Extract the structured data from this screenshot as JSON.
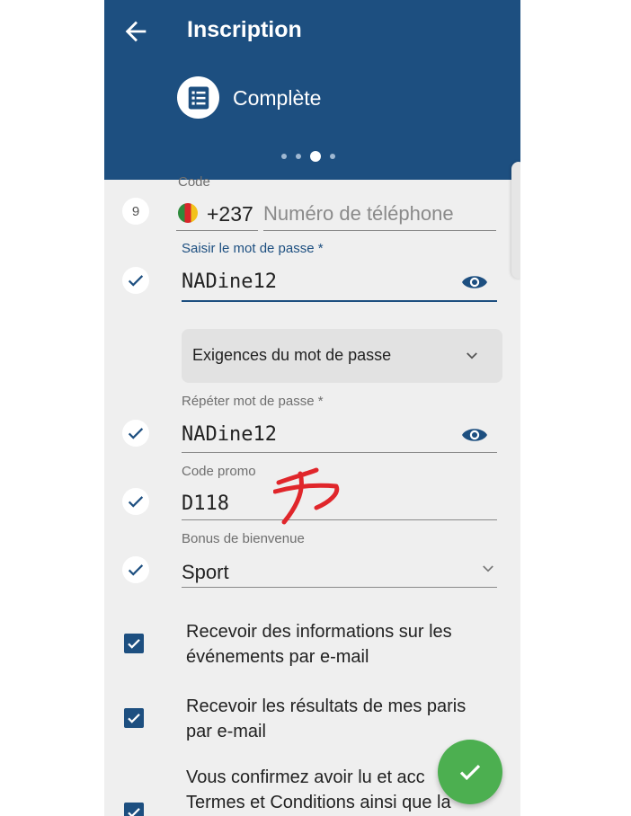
{
  "header": {
    "title": "Inscription",
    "step_label": "Complète",
    "bg_color": "#1d4f80",
    "dots_total": 4,
    "dot_active_index": 2
  },
  "form": {
    "phone": {
      "label": "Code",
      "step_number": "9",
      "country_code": "+237",
      "placeholder": "Numéro de téléphone",
      "value": ""
    },
    "password": {
      "label": "Saisir le mot de passe *",
      "value": "NADine12"
    },
    "requirements": {
      "label": "Exigences du mot de passe"
    },
    "repeat_password": {
      "label": "Répéter mot de passe *",
      "value": "NADine12"
    },
    "promo": {
      "label": "Code promo",
      "value": "D118"
    },
    "bonus": {
      "label": "Bonus de bienvenue",
      "value": "Sport"
    }
  },
  "checkboxes": [
    {
      "line1": "Recevoir des informations sur les",
      "line2": "événements par e-mail",
      "checked": true
    },
    {
      "line1": "Recevoir les résultats de mes paris",
      "line2": "par e-mail",
      "checked": true
    },
    {
      "line1": "Vous confirmez avoir lu et acc",
      "line2": "Termes et Conditions ainsi que la",
      "checked": true
    }
  ],
  "fab": {
    "icon": "check-icon",
    "color": "#4caf50"
  },
  "colors": {
    "accent": "#1d4f80",
    "check_blue": "#1d4f80",
    "annotation_red": "#e0262b"
  }
}
